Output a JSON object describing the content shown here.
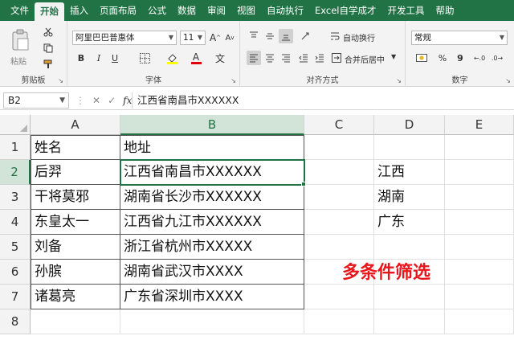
{
  "menu": {
    "tabs": [
      "文件",
      "开始",
      "插入",
      "页面布局",
      "公式",
      "数据",
      "审阅",
      "视图",
      "自动执行",
      "Excel自学成才",
      "开发工具",
      "帮助"
    ],
    "active_index": 1
  },
  "ribbon": {
    "clipboard": {
      "paste_label": "粘贴",
      "group_label": "剪贴板"
    },
    "font": {
      "font_name": "阿里巴巴普惠体",
      "font_size": "11",
      "bold": "B",
      "italic": "I",
      "underline": "U",
      "grow": "A",
      "shrink": "A",
      "group_label": "字体"
    },
    "alignment": {
      "wrap_text": "自动换行",
      "merge_center": "合并后居中",
      "group_label": "对齐方式"
    },
    "number": {
      "format": "常规",
      "percent": "%",
      "comma": "9",
      "group_label": "数字"
    }
  },
  "formula_bar": {
    "name_box": "B2",
    "fx": "fx",
    "content": "江西省南昌市XXXXXX"
  },
  "sheet": {
    "columns": [
      "A",
      "B",
      "C",
      "D",
      "E"
    ],
    "rows": [
      "1",
      "2",
      "3",
      "4",
      "5",
      "6",
      "7",
      "8"
    ],
    "selected_col": "B",
    "selected_row": "2",
    "table": [
      [
        "姓名",
        "地址"
      ],
      [
        "后羿",
        "江西省南昌市XXXXXX"
      ],
      [
        "干将莫邪",
        "湖南省长沙市XXXXXX"
      ],
      [
        "东皇太一",
        "江西省九江市XXXXXX"
      ],
      [
        "刘备",
        "浙江省杭州市XXXXX"
      ],
      [
        "孙膑",
        "湖南省武汉市XXXX"
      ],
      [
        "诸葛亮",
        "广东省深圳市XXXX"
      ]
    ],
    "criteria": [
      "江西",
      "湖南",
      "广东"
    ],
    "annotation": "多条件筛选"
  },
  "colors": {
    "accent": "#217346",
    "annotation": "#e8151b"
  }
}
